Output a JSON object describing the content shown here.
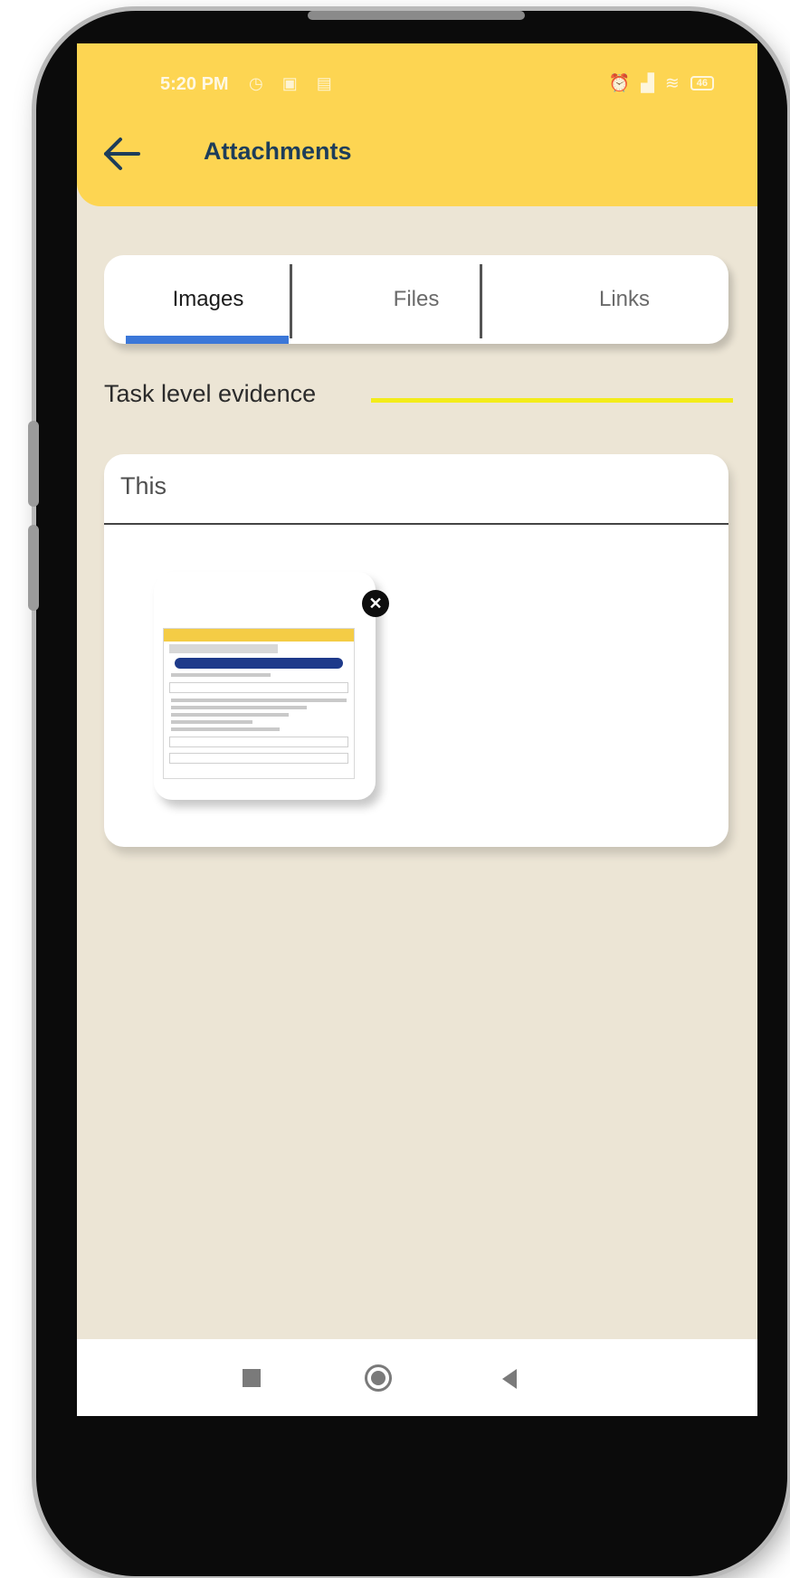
{
  "status_bar": {
    "time": "5:20 PM",
    "left_icons": [
      "alarm-icon",
      "calendar-icon",
      "message-icon"
    ],
    "right_icons": [
      "alarm-icon",
      "data-icon",
      "signal-icon",
      "wifi-icon",
      "battery-icon"
    ],
    "battery": "46"
  },
  "header": {
    "title": "Attachments",
    "background": "#fdd552",
    "title_color": "#1d3d5a"
  },
  "tabs": [
    {
      "label": "Images",
      "active": true
    },
    {
      "label": "Files",
      "active": false
    },
    {
      "label": "Links",
      "active": false
    }
  ],
  "section": {
    "label": "Task level evidence",
    "accent": "#f3ec1a"
  },
  "card": {
    "title": "This",
    "attachments": [
      {
        "type": "image-thumbnail",
        "removable": true
      }
    ]
  },
  "nav_bar": {
    "buttons": [
      "recents-icon",
      "home-icon",
      "back-icon"
    ]
  },
  "colors": {
    "screen_bg": "#ece5d5",
    "tab_indicator": "#3b77d8"
  }
}
